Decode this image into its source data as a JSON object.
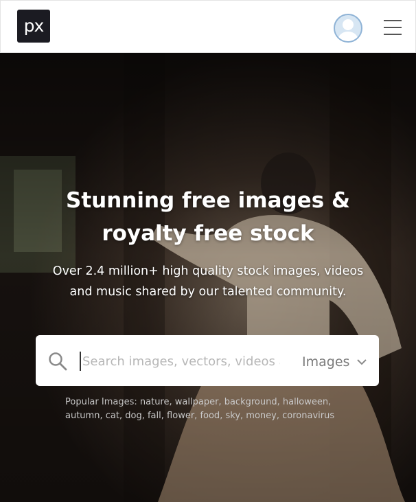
{
  "header": {
    "logo_text": "px",
    "avatar_icon": "user-avatar-icon",
    "menu_icon": "hamburger-menu-icon"
  },
  "hero": {
    "title_line1": "Stunning free images &",
    "title_line2": "royalty free stock",
    "subtitle_line1": "Over 2.4 million+ high quality stock images, videos",
    "subtitle_line2": "and music shared by our talented community."
  },
  "search": {
    "placeholder": "Search images, vectors, videos and",
    "value": "",
    "type_selected": "Images",
    "search_icon": "search-icon"
  },
  "popular": {
    "label": "Popular Images:",
    "tags": [
      "nature",
      "wallpaper",
      "background",
      "halloween",
      "autumn",
      "cat",
      "dog",
      "fall",
      "flower",
      "food",
      "sky",
      "money",
      "coronavirus"
    ]
  },
  "colors": {
    "logo_bg": "#1b1b22",
    "header_bg": "#ffffff",
    "avatar_fill": "#d7e6f3",
    "text_white": "#ffffff"
  }
}
